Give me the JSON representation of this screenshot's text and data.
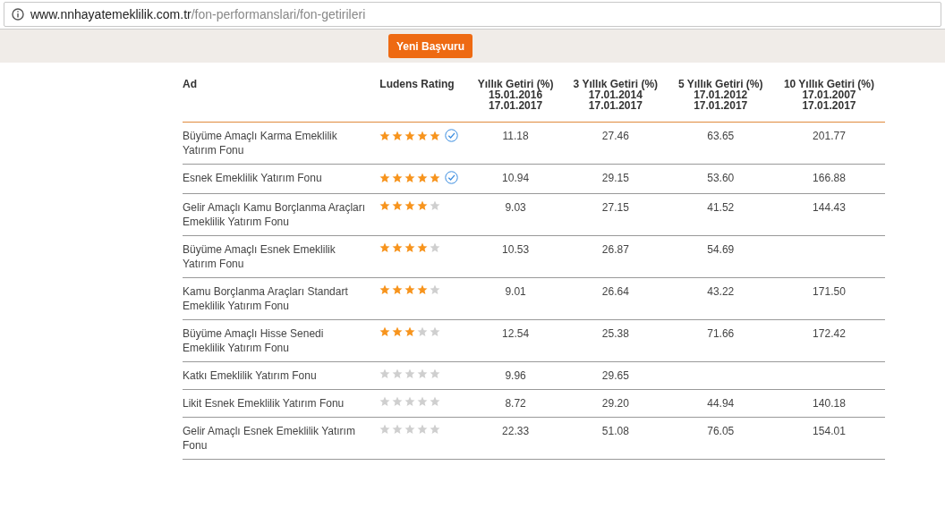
{
  "address_bar": {
    "domain": "www.nnhayatemeklilik.com.tr",
    "path": "/fon-performanslari/fon-getirileri"
  },
  "apply_button": "Yeni Başvuru",
  "table": {
    "columns": [
      {
        "title": "Ad"
      },
      {
        "title": "Ludens Rating"
      },
      {
        "title": "Yıllık Getiri (%)",
        "dates": [
          "15.01.2016",
          "17.01.2017"
        ]
      },
      {
        "title": "3 Yıllık Getiri (%)",
        "dates": [
          "17.01.2014",
          "17.01.2017"
        ]
      },
      {
        "title": "5 Yıllık Getiri (%)",
        "dates": [
          "17.01.2012",
          "17.01.2017"
        ]
      },
      {
        "title": "10 Yıllık Getiri (%)",
        "dates": [
          "17.01.2007",
          "17.01.2017"
        ]
      }
    ],
    "rows": [
      {
        "name": "Büyüme Amaçlı Karma Emeklilik Yatırım Fonu",
        "stars": 5,
        "verified": true,
        "annual": "11.18",
        "three_year": "27.46",
        "five_year": "63.65",
        "ten_year": "201.77"
      },
      {
        "name": "Esnek Emeklilik Yatırım Fonu",
        "stars": 5,
        "verified": true,
        "annual": "10.94",
        "three_year": "29.15",
        "five_year": "53.60",
        "ten_year": "166.88"
      },
      {
        "name": "Gelir Amaçlı Kamu Borçlanma Araçları Emeklilik Yatırım Fonu",
        "stars": 4,
        "verified": false,
        "annual": "9.03",
        "three_year": "27.15",
        "five_year": "41.52",
        "ten_year": "144.43"
      },
      {
        "name": "Büyüme Amaçlı Esnek Emeklilik Yatırım Fonu",
        "stars": 4,
        "verified": false,
        "annual": "10.53",
        "three_year": "26.87",
        "five_year": "54.69"
      },
      {
        "name": "Kamu Borçlanma Araçları Standart Emeklilik Yatırım Fonu",
        "stars": 4,
        "verified": false,
        "annual": "9.01",
        "three_year": "26.64",
        "five_year": "43.22",
        "ten_year": "171.50"
      },
      {
        "name": "Büyüme Amaçlı Hisse Senedi Emeklilik Yatırım Fonu",
        "stars": 3,
        "verified": false,
        "annual": "12.54",
        "three_year": "25.38",
        "five_year": "71.66",
        "ten_year": "172.42"
      },
      {
        "name": "Katkı Emeklilik Yatırım Fonu",
        "stars": 0,
        "verified": false,
        "annual": "9.96",
        "three_year": "29.65"
      },
      {
        "name": "Likit Esnek Emeklilik Yatırım Fonu",
        "stars": 0,
        "verified": false,
        "annual": "8.72",
        "three_year": "29.20",
        "five_year": "44.94",
        "ten_year": "140.18"
      },
      {
        "name": "Gelir Amaçlı Esnek Emeklilik Yatırım Fonu",
        "stars": 0,
        "verified": false,
        "annual": "22.33",
        "three_year": "51.08",
        "five_year": "76.05",
        "ten_year": "154.01"
      }
    ]
  }
}
